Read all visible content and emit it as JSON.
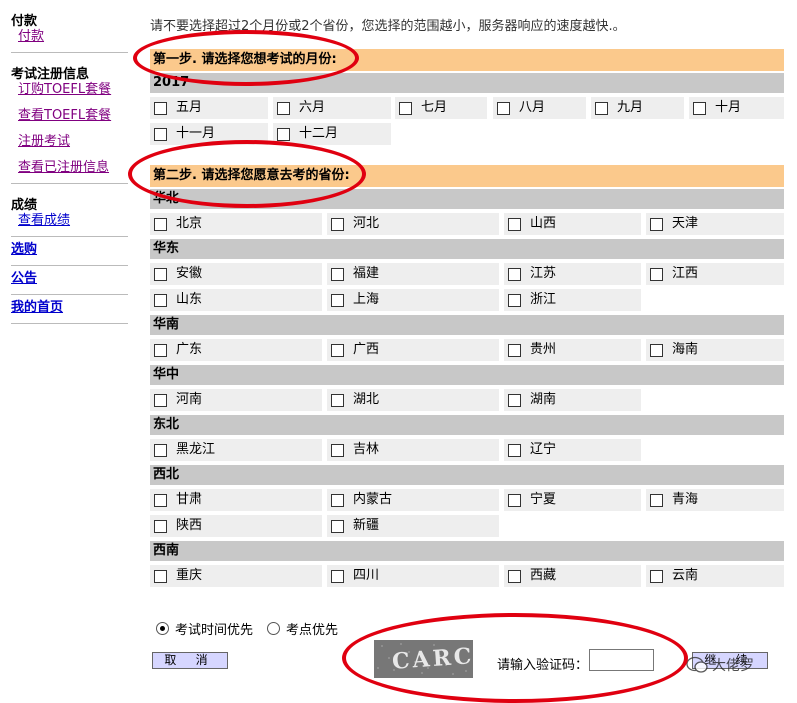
{
  "sidebar": {
    "payment_header": "付款",
    "payment_link": "付款",
    "reg_header": "考试注册信息",
    "reg_links": [
      "订购TOEFL套餐",
      "查看TOEFL套餐",
      "注册考试",
      "查看已注册信息"
    ],
    "scores_header": "成绩",
    "scores_link": "查看成绩",
    "top_links": [
      "选购",
      "公告",
      "我的首页"
    ]
  },
  "main": {
    "notice": "请不要选择超过2个月份或2个省份，您选择的范围越小，服务器响应的速度越快.。",
    "step1": "第一步. 请选择您想考试的月份:",
    "year": "2017",
    "months": [
      "五月",
      "六月",
      "七月",
      "八月",
      "九月",
      "十月",
      "十一月",
      "十二月"
    ],
    "step2": "第二步. 请选择您愿意去考的省份:",
    "regions": [
      {
        "name": "华北",
        "provinces": [
          "北京",
          "河北",
          "山西",
          "天津"
        ]
      },
      {
        "name": "华东",
        "provinces": [
          "安徽",
          "福建",
          "江苏",
          "江西",
          "山东",
          "上海",
          "浙江"
        ]
      },
      {
        "name": "华南",
        "provinces": [
          "广东",
          "广西",
          "贵州",
          "海南"
        ]
      },
      {
        "name": "华中",
        "provinces": [
          "河南",
          "湖北",
          "湖南"
        ]
      },
      {
        "name": "东北",
        "provinces": [
          "黑龙江",
          "吉林",
          "辽宁"
        ]
      },
      {
        "name": "西北",
        "provinces": [
          "甘肃",
          "内蒙古",
          "宁夏",
          "青海",
          "陕西",
          "新疆"
        ]
      },
      {
        "name": "西南",
        "provinces": [
          "重庆",
          "四川",
          "西藏",
          "云南"
        ]
      }
    ],
    "priority_options": [
      "考试时间优先",
      "考点优先"
    ],
    "cancel_label": "取 消",
    "continue_label": "继 续",
    "captcha_text": "CARC",
    "captcha_label": "请输入验证码：",
    "captcha_value": ""
  },
  "watermark": "大佬罗",
  "colors": {
    "step_bg": "#fbc98c",
    "region_bg": "#c8c8c8",
    "cell_bg": "#eeeeee",
    "annotation": "#e00010",
    "link": "#0000cc",
    "visited": "#800080"
  }
}
